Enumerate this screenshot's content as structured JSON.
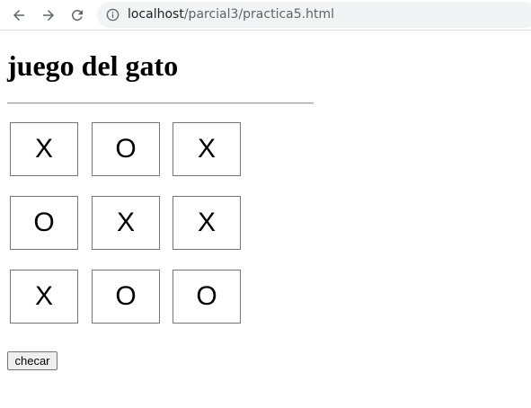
{
  "browser": {
    "url_host": "localhost",
    "url_path": "/parcial3/practica5.html"
  },
  "page": {
    "title": "juego del gato",
    "board": [
      [
        "X",
        "O",
        "X"
      ],
      [
        "O",
        "X",
        "X"
      ],
      [
        "X",
        "O",
        "O"
      ]
    ],
    "check_button_label": "checar"
  }
}
